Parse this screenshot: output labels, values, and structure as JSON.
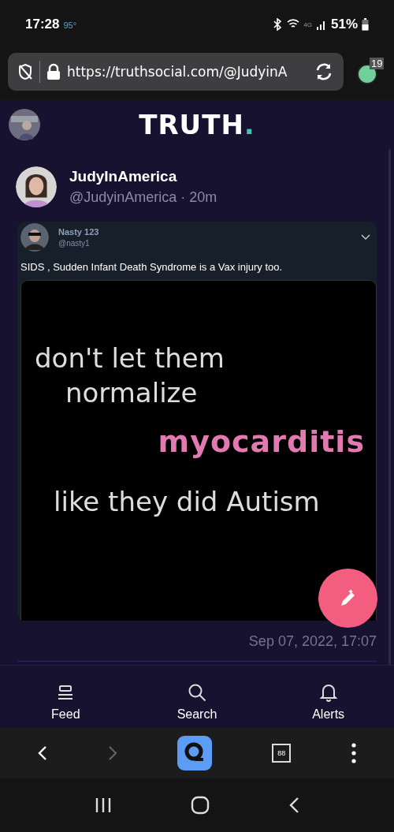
{
  "status_bar": {
    "time": "17:28",
    "temperature": "95°",
    "network": "4G",
    "battery": "51%"
  },
  "browser": {
    "url": "https://truthsocial.com/@JudyinA",
    "tab_count": "19"
  },
  "header": {
    "logo": "TRUTH",
    "logo_dot": "."
  },
  "post": {
    "display_name": "JudyInAmerica",
    "handle": "@JudyinAmerica · 20m",
    "quote": {
      "display_name": "Nasty 123",
      "handle": "@nasty1",
      "text": "SIDS , Sudden Infant Death Syndrome is a Vax injury too.",
      "image_lines": [
        {
          "text": "don't let them",
          "kind": "plain"
        },
        {
          "text": "normalize",
          "kind": "plain"
        },
        {
          "text": "myocarditis",
          "kind": "glitch"
        },
        {
          "text": "like they did Autism",
          "kind": "plain"
        }
      ]
    },
    "timestamp": "Sep 07, 2022, 17:07"
  },
  "bottom_nav": [
    {
      "label": "Feed",
      "kind": "feed"
    },
    {
      "label": "Search",
      "kind": "search"
    },
    {
      "label": "Alerts",
      "kind": "alerts"
    }
  ],
  "browser_toolbar": {
    "tabs_label": "88"
  }
}
